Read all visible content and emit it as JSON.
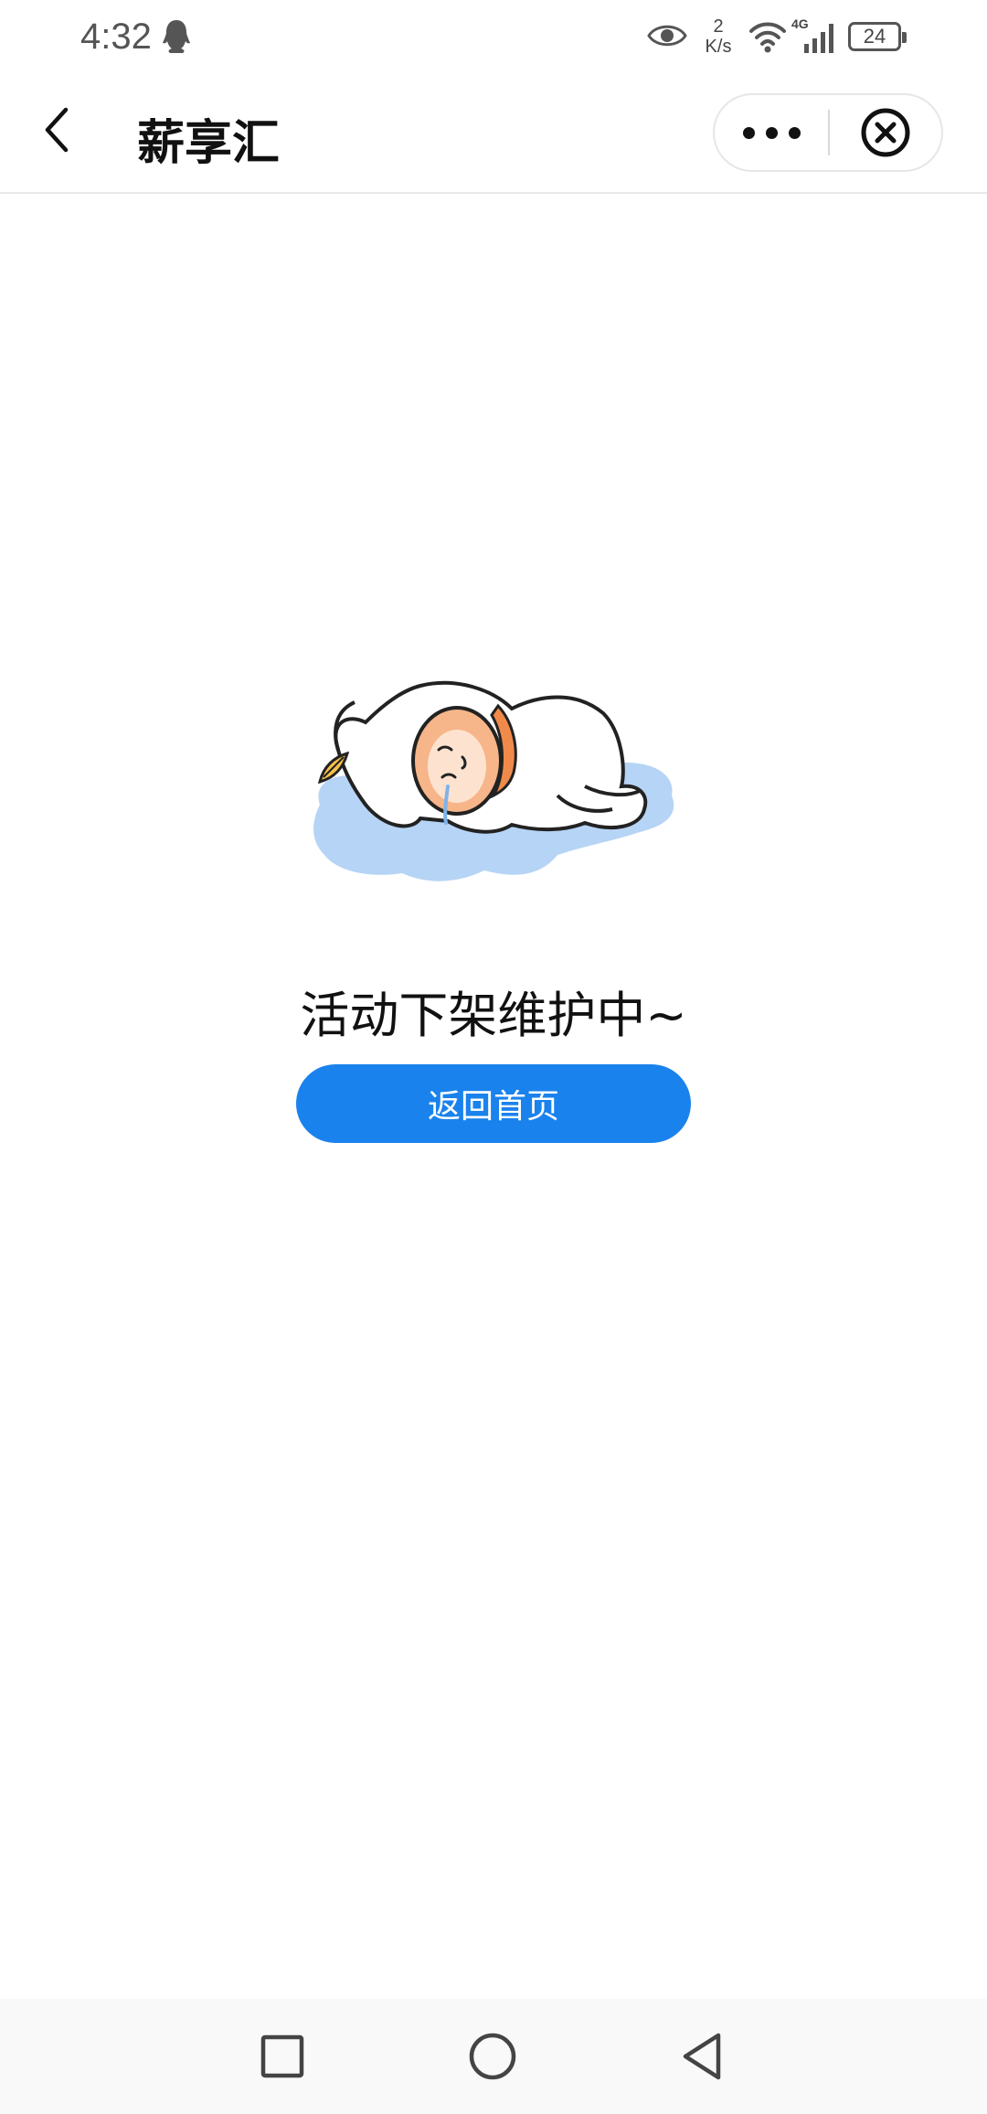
{
  "status_bar": {
    "time": "4:32",
    "net_speed_value": "2",
    "net_speed_unit": "K/s",
    "signal_label": "4G",
    "battery_level": "24",
    "icons": [
      "qq-icon",
      "eye-icon",
      "wifi-icon",
      "signal-icon",
      "battery-icon"
    ]
  },
  "nav_bar": {
    "title": "薪享汇",
    "back_icon": "chevron-left-icon",
    "more_icon": "more-dots-icon",
    "close_icon": "close-circle-icon"
  },
  "content": {
    "illustration": "sleeping-character-illustration",
    "message": "活动下架维护中~",
    "home_button_label": "返回首页"
  },
  "system_nav": {
    "icons": [
      "recent-apps-icon",
      "home-icon",
      "back-icon"
    ]
  },
  "colors": {
    "accent": "#1a82ec",
    "background": "#ffffff",
    "puddle": "#b6d4f5",
    "face": "#f7b58a"
  }
}
